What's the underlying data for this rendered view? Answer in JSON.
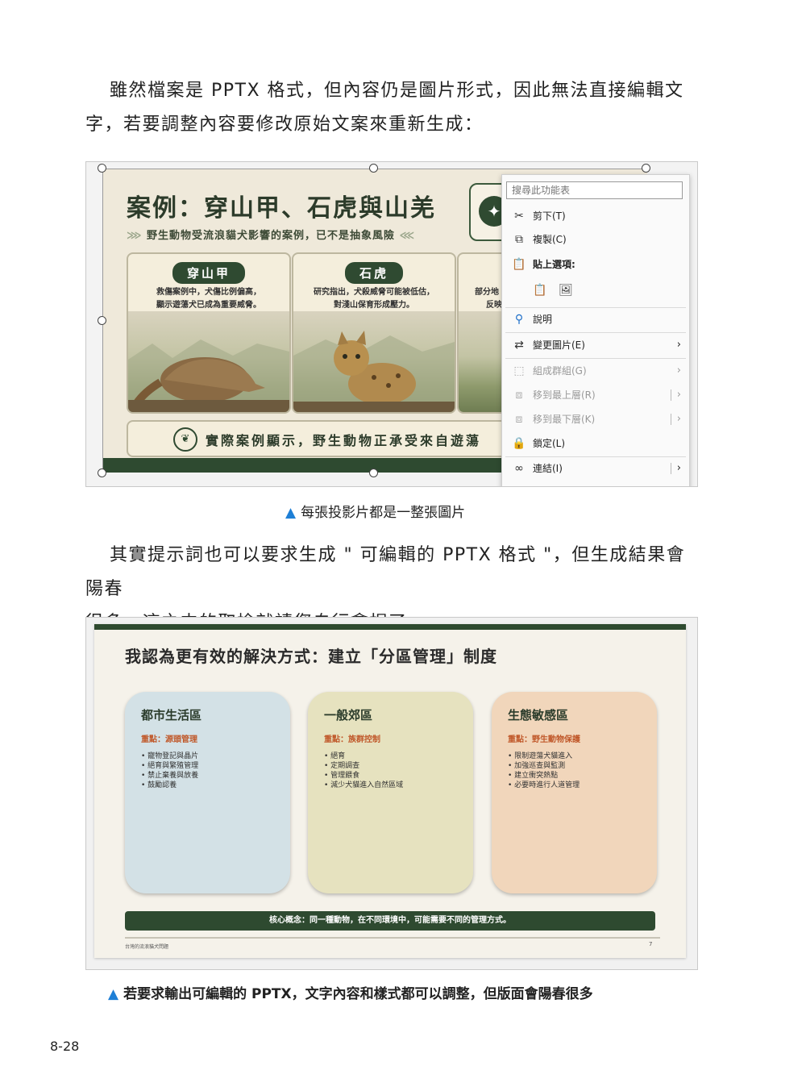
{
  "intro": {
    "line1": "雖然檔案是 PPTX 格式，但內容仍是圖片形式，因此無法直接編輯文",
    "line2": "字，若要調整內容要修改原始文案來重新生成："
  },
  "slide1": {
    "title": "案例：穿山甲、石虎與山羌",
    "subtitle": "野生動物受流浪貓犬影響的案例，已不是抽象風險",
    "cards": [
      {
        "tag": "穿山甲",
        "desc1": "救傷案例中，犬傷比例偏高，",
        "desc2": "顯示遊蕩犬已成為重要威脅。"
      },
      {
        "tag": "石虎",
        "desc1": "研究指出，犬殺威脅可能被低估，",
        "desc2": "對淺山保育形成壓力。"
      },
      {
        "tag": "",
        "desc1": "部分地",
        "desc2": "反映"
      }
    ],
    "bottom_text": "實際案例顯示，野生動物正承受來自遊蕩",
    "icons": {
      "bulb": "lightbulb-icon",
      "leaf": "leaf-icon"
    },
    "colors": {
      "dark_green": "#2e4a30",
      "background": "#efe9da"
    }
  },
  "context_menu": {
    "search_placeholder": "搜尋此功能表",
    "items": [
      {
        "label": "剪下(T)",
        "icon": "scissors-icon"
      },
      {
        "label": "複製(C)",
        "icon": "copy-icon"
      },
      {
        "label": "貼上選項:",
        "icon": "paste-icon"
      },
      {
        "label": "說明",
        "icon": "help-icon"
      },
      {
        "label": "變更圖片(E)",
        "icon": "change-picture-icon"
      },
      {
        "label": "組成群組(G)",
        "icon": "group-icon"
      },
      {
        "label": "移到最上層(R)",
        "icon": "bring-front-icon"
      },
      {
        "label": "移到最下層(K)",
        "icon": "send-back-icon"
      },
      {
        "label": "鎖定(L)",
        "icon": "lock-icon"
      },
      {
        "label": "連結(I)",
        "icon": "link-icon"
      }
    ]
  },
  "caption1": "每張投影片都是一整張圖片",
  "middle": {
    "line1": "其實提示詞也可以要求生成 \" 可編輯的 PPTX 格式 \"，但生成結果會陽春",
    "line2": "很多，這之中的取捨就請您自行拿捏了。"
  },
  "slide2": {
    "title": "我認為更有效的解決方式：建立「分區管理」制度",
    "zones": [
      {
        "title": "都市生活區",
        "focus": "重點：源頭管理",
        "items": [
          "寵物登記與晶片",
          "絕育與繁殖管理",
          "禁止棄養與放養",
          "鼓勵認養"
        ],
        "color": "#d3e1e6"
      },
      {
        "title": "一般郊區",
        "focus": "重點：族群控制",
        "items": [
          "絕育",
          "定期調查",
          "管理餵食",
          "減少犬貓進入自然區域"
        ],
        "color": "#e6e2bf"
      },
      {
        "title": "生態敏感區",
        "focus": "重點：野生動物保護",
        "items": [
          "限制遊蕩犬貓進入",
          "加強巡查與監測",
          "建立衝突熱點",
          "必要時進行人道管理"
        ],
        "color": "#f1d6bb"
      }
    ],
    "concept": "核心概念：同一種動物，在不同環境中，可能需要不同的管理方式。",
    "footer": "台灣的流浪貓犬問題",
    "page": "7",
    "colors": {
      "focus_text": "#c0582a",
      "dark_green": "#2e4a30"
    }
  },
  "caption2": "若要求輸出可編輯的 PPTX，文字內容和樣式都可以調整，但版面會陽春很多",
  "page_number": "8-28"
}
